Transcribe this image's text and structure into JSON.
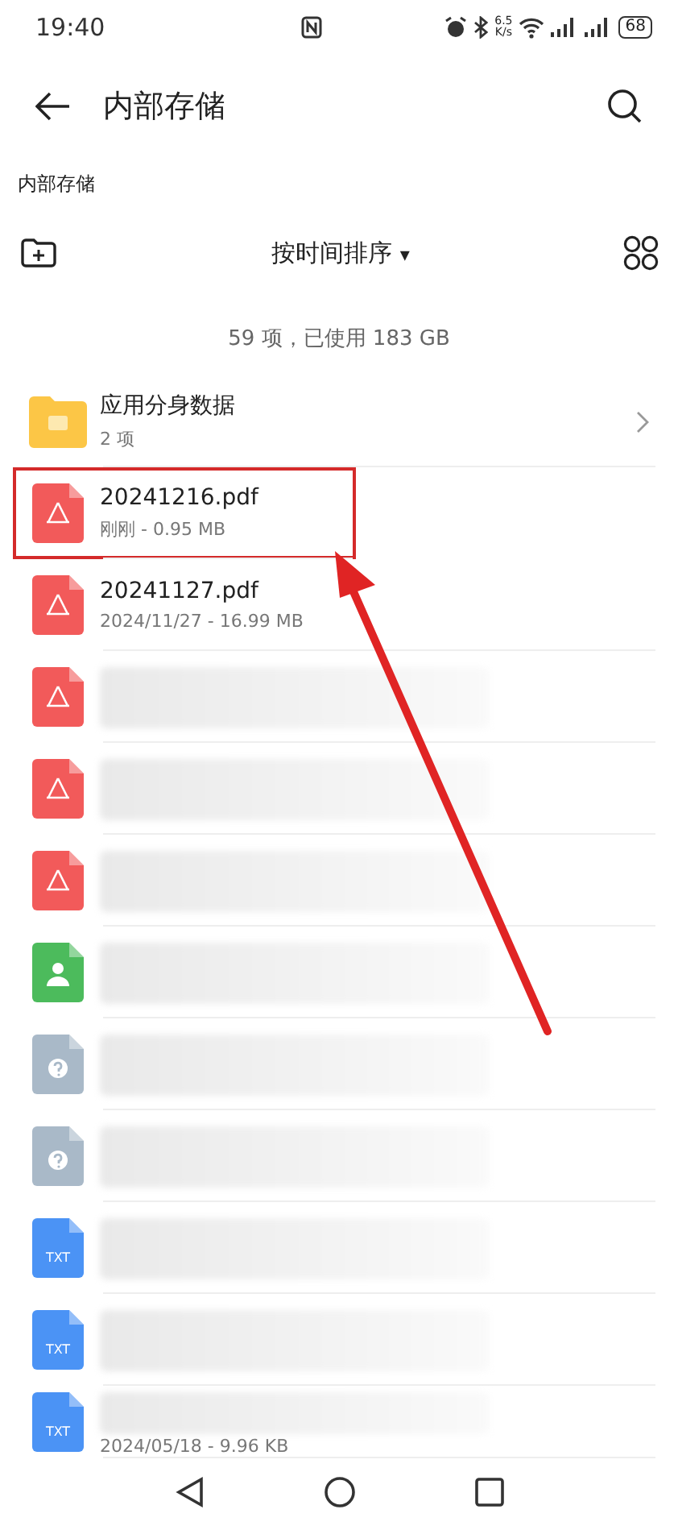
{
  "status_bar": {
    "time": "19:40",
    "speed_value": "6.5",
    "speed_unit": "K/s",
    "battery": "68"
  },
  "header": {
    "title": "内部存储"
  },
  "breadcrumb": "内部存储",
  "toolbar": {
    "sort_label": "按时间排序",
    "sort_caret": "▾"
  },
  "summary": "59 项，已使用 183 GB",
  "files": [
    {
      "kind": "folder",
      "name": "应用分身数据",
      "meta": "2 项",
      "blurred": false,
      "highlighted": false
    },
    {
      "kind": "pdf",
      "name": "20241216.pdf",
      "meta": "刚刚 - 0.95 MB",
      "blurred": false,
      "highlighted": true
    },
    {
      "kind": "pdf",
      "name": "20241127.pdf",
      "meta": "2024/11/27 - 16.99 MB",
      "blurred": false,
      "highlighted": false
    },
    {
      "kind": "pdf",
      "blurred": true,
      "highlighted": false
    },
    {
      "kind": "pdf",
      "blurred": true,
      "highlighted": false
    },
    {
      "kind": "pdf",
      "blurred": true,
      "highlighted": false
    },
    {
      "kind": "contact",
      "blurred": true,
      "highlighted": false
    },
    {
      "kind": "unknown",
      "blurred": true,
      "highlighted": false
    },
    {
      "kind": "unknown",
      "blurred": true,
      "highlighted": false
    },
    {
      "kind": "txt",
      "icon_label": "TXT",
      "blurred": true,
      "highlighted": false
    },
    {
      "kind": "txt",
      "icon_label": "TXT",
      "blurred": true,
      "highlighted": false
    },
    {
      "kind": "txt",
      "icon_label": "TXT",
      "meta": "2024/05/18 - 9.96 KB",
      "blurred": true,
      "highlighted": false
    }
  ]
}
